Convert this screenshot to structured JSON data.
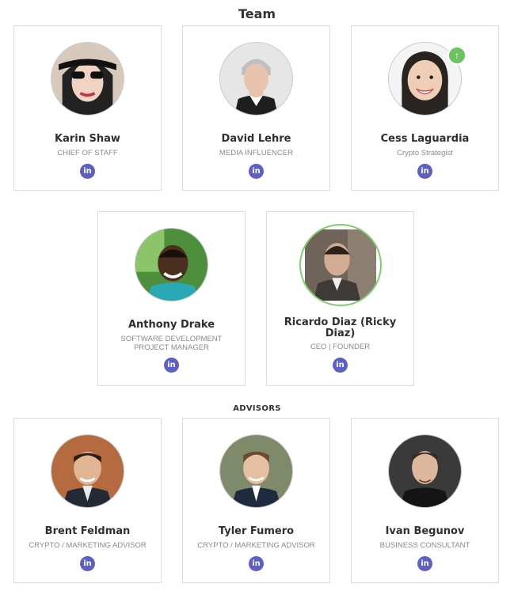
{
  "page": {
    "title": "Team"
  },
  "team": [
    {
      "name": "Karin Shaw",
      "role": "CHIEF OF STAFF",
      "linkedin": "in",
      "avatar_icon": "person-photo"
    },
    {
      "name": "David Lehre",
      "role": "MEDIA INFLUENCER",
      "linkedin": "in",
      "avatar_icon": "person-photo"
    },
    {
      "name": "Cess Laguardia",
      "role": "Crypto Strategist",
      "linkedin": "in",
      "avatar_icon": "person-photo",
      "badge_icon": "arrow-up-icon"
    },
    {
      "name": "Anthony Drake",
      "role_lines": [
        "SOFTWARE DEVELOPMENT",
        "PROJECT MANAGER"
      ],
      "linkedin": "in",
      "avatar_icon": "person-photo"
    },
    {
      "name_lines": [
        "Ricardo Diaz (Ricky",
        "Diaz)"
      ],
      "role": "CEO | FOUNDER",
      "linkedin": "in",
      "avatar_icon": "person-photo"
    }
  ],
  "advisors_label": "ADVISORS",
  "advisors": [
    {
      "name": "Brent Feldman",
      "role": "CRYPTO / MARKETING ADVISOR",
      "linkedin": "in",
      "avatar_icon": "person-photo"
    },
    {
      "name": "Tyler Fumero",
      "role": "CRYPTO / MARKETING ADVISOR",
      "linkedin": "in",
      "avatar_icon": "person-photo"
    },
    {
      "name": "Ivan Begunov",
      "role": "BUSINESS CONSULTANT",
      "linkedin": "in",
      "avatar_icon": "person-photo"
    }
  ],
  "colors": {
    "linkedin": "#5b5fc7",
    "badge": "#6cc45f",
    "featured_ring": "#7ecf6e",
    "card_border": "#dcdcdc"
  }
}
